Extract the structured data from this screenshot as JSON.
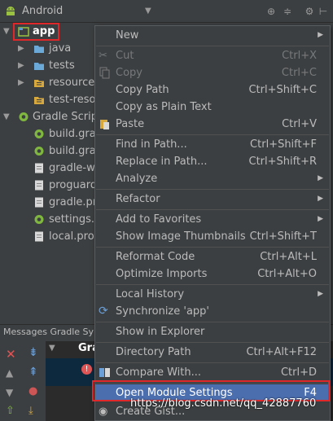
{
  "topbar": {
    "title": "Android"
  },
  "tree": {
    "items": [
      {
        "label": "app"
      },
      {
        "label": "java"
      },
      {
        "label": "tests"
      },
      {
        "label": "resources"
      },
      {
        "label": "test-resou"
      },
      {
        "label": "Gradle Script"
      },
      {
        "label": "build.grac"
      },
      {
        "label": "build.grac"
      },
      {
        "label": "gradle-wr"
      },
      {
        "label": "proguard"
      },
      {
        "label": "gradle.pro"
      },
      {
        "label": "settings.g"
      },
      {
        "label": "local.prop"
      }
    ]
  },
  "messages": {
    "title": "Messages Gradle Sync",
    "row_label": "Grad"
  },
  "menu": {
    "items": [
      {
        "label": "New",
        "shortcut": ""
      },
      {
        "label": "Cut",
        "shortcut": "Ctrl+X"
      },
      {
        "label": "Copy",
        "shortcut": "Ctrl+C"
      },
      {
        "label": "Copy Path",
        "shortcut": "Ctrl+Shift+C"
      },
      {
        "label": "Copy as Plain Text",
        "shortcut": ""
      },
      {
        "label": "Paste",
        "shortcut": "Ctrl+V"
      },
      {
        "label": "Find in Path...",
        "shortcut": "Ctrl+Shift+F"
      },
      {
        "label": "Replace in Path...",
        "shortcut": "Ctrl+Shift+R"
      },
      {
        "label": "Analyze",
        "shortcut": ""
      },
      {
        "label": "Refactor",
        "shortcut": ""
      },
      {
        "label": "Add to Favorites",
        "shortcut": ""
      },
      {
        "label": "Show Image Thumbnails",
        "shortcut": "Ctrl+Shift+T"
      },
      {
        "label": "Reformat Code",
        "shortcut": "Ctrl+Alt+L"
      },
      {
        "label": "Optimize Imports",
        "shortcut": "Ctrl+Alt+O"
      },
      {
        "label": "Local History",
        "shortcut": ""
      },
      {
        "label": "Synchronize 'app'",
        "shortcut": ""
      },
      {
        "label": "Show in Explorer",
        "shortcut": ""
      },
      {
        "label": "Directory Path",
        "shortcut": "Ctrl+Alt+F12"
      },
      {
        "label": "Compare With...",
        "shortcut": "Ctrl+D"
      },
      {
        "label": "Open Module Settings",
        "shortcut": "F4"
      },
      {
        "label": "Create Gist...",
        "shortcut": ""
      }
    ]
  },
  "watermark": "https://blog.csdn.net/qq_42887760",
  "colors": {
    "highlight": "#4b6eaf",
    "annotation_red": "#e0282b",
    "background": "#3c3f41"
  }
}
